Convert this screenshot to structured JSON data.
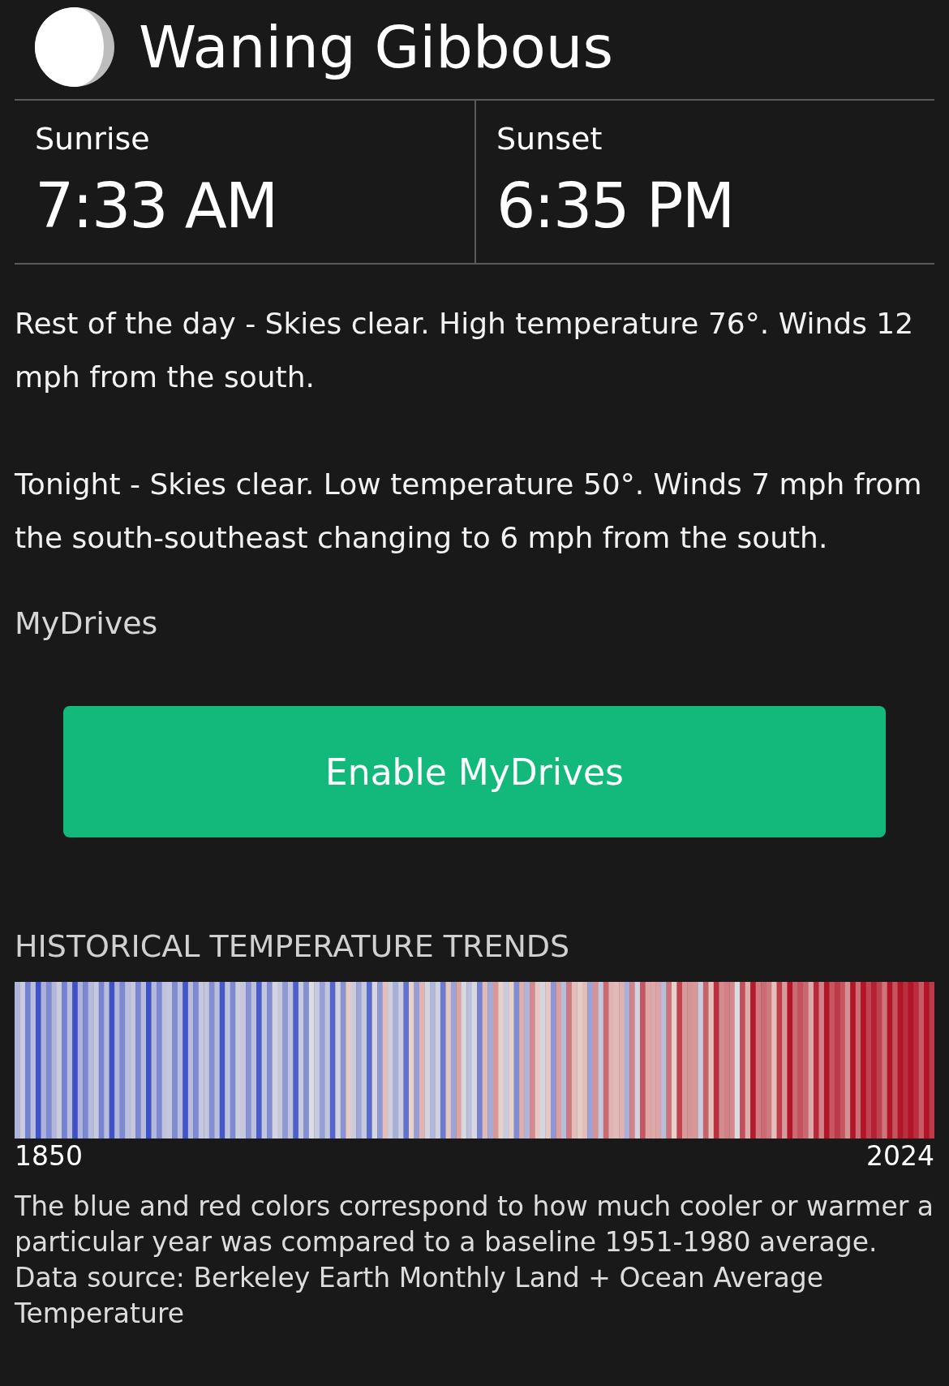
{
  "moon": {
    "phase": "Waning Gibbous"
  },
  "sun": [
    {
      "label": "Sunrise",
      "time": "7:33 AM"
    },
    {
      "label": "Sunset",
      "time": "6:35 PM"
    }
  ],
  "forecast": [
    "Rest of the day - Skies clear. High temperature 76°. Winds 12 mph from the south.",
    "Tonight - Skies clear. Low temperature 50°. Winds 7 mph from the south-southeast changing to 6 mph from the south."
  ],
  "mydrives": {
    "title": "MyDrives",
    "button": "Enable MyDrives"
  },
  "trends": {
    "title": "HISTORICAL TEMPERATURE TRENDS",
    "start_year": "1850",
    "end_year": "2024",
    "note": "The blue and red colors correspond to how much cooler or warmer a particular year was compared to a baseline 1951-1980 average. Data source: Berkeley Earth Monthly Land + Ocean Average Temperature"
  }
}
